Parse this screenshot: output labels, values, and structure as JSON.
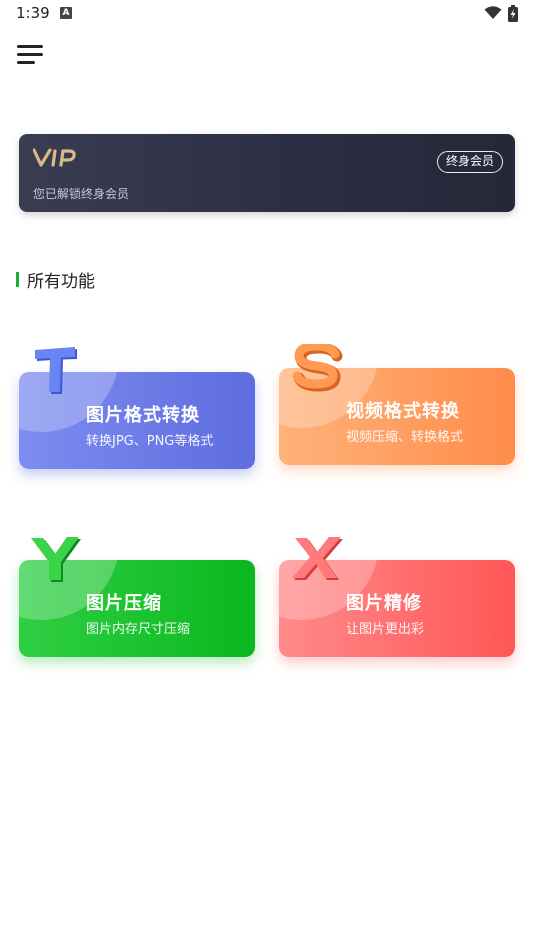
{
  "status_bar": {
    "time": "1:39",
    "notification_icon": "a-icon",
    "wifi_icon": "wifi-icon",
    "battery_icon": "battery-charging-icon"
  },
  "header": {
    "menu_icon": "hamburger-menu-icon"
  },
  "vip": {
    "logo_text": "VIP",
    "status_text": "您已解锁终身会员",
    "badge_label": "终身会员",
    "colors": {
      "card": "#2c2f43",
      "logo": "#d9b98a"
    }
  },
  "section": {
    "title": "所有功能",
    "accent_color": "#17b13a"
  },
  "features": [
    {
      "letter": "T",
      "title": "图片格式转换",
      "subtitle": "转换JPG、PNG等格式",
      "color": "#6a78e6",
      "letter_color": "#5b71e8"
    },
    {
      "letter": "S",
      "title": "视频格式转换",
      "subtitle": "视频压缩、转换格式",
      "color": "#ff9a5a",
      "letter_color": "#f58a3c"
    },
    {
      "letter": "Y",
      "title": "图片压缩",
      "subtitle": "图片内存尺寸压缩",
      "color": "#16bd2c",
      "letter_color": "#19b82f"
    },
    {
      "letter": "X",
      "title": "图片精修",
      "subtitle": "让图片更出彩",
      "color": "#ff6b6b",
      "letter_color": "#f25a5a"
    }
  ]
}
